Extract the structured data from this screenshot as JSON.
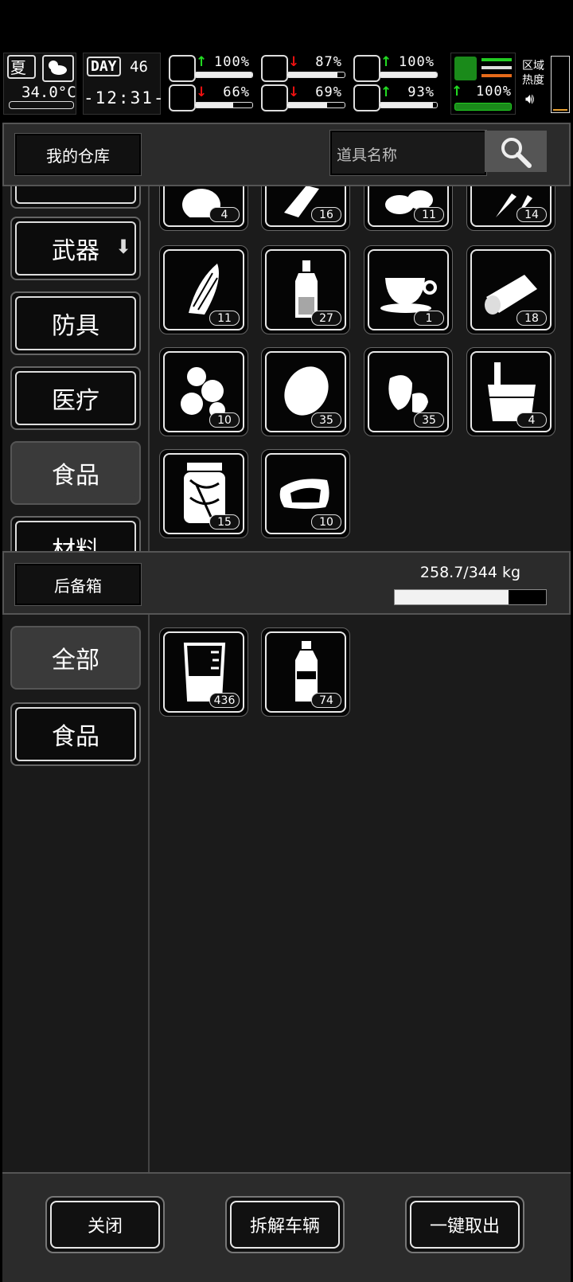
{
  "hud": {
    "season": "夏",
    "temperature": "34.0°C",
    "day_label": "DAY",
    "day_number": "46",
    "clock": "-12:31-",
    "stats": [
      {
        "name": "health",
        "trend": "up",
        "value": "100%",
        "level": 1.0
      },
      {
        "name": "stomach",
        "trend": "down",
        "value": "87%",
        "level": 0.87
      },
      {
        "name": "stamina",
        "trend": "up",
        "value": "100%",
        "level": 1.0
      },
      {
        "name": "mind",
        "trend": "down",
        "value": "66%",
        "level": 0.66
      },
      {
        "name": "water",
        "trend": "down",
        "value": "69%",
        "level": 0.69
      },
      {
        "name": "heart",
        "trend": "up",
        "value": "93%",
        "level": 0.93
      }
    ],
    "speed": {
      "trend": "up",
      "value": "100%"
    },
    "zone_heat_label": "区域\n热度",
    "zone_heat_line1": "区域",
    "zone_heat_line2": "热度"
  },
  "warehouse": {
    "title": "我的仓库",
    "search_placeholder": "道具名称",
    "categories": [
      "武器",
      "防具",
      "医疗",
      "食品",
      "材料"
    ],
    "selected_category": "食品",
    "items": [
      {
        "icon": "potato-icon",
        "count": "4"
      },
      {
        "icon": "bread-icon",
        "count": "16"
      },
      {
        "icon": "beans-icon",
        "count": "11"
      },
      {
        "icon": "carrot-icon",
        "count": "14"
      },
      {
        "icon": "corn-icon",
        "count": "11"
      },
      {
        "icon": "bottle-icon",
        "count": "27"
      },
      {
        "icon": "coffee-cup-icon",
        "count": "1"
      },
      {
        "icon": "canned-food-icon",
        "count": "18"
      },
      {
        "icon": "ginger-icon",
        "count": "10"
      },
      {
        "icon": "lemon-icon",
        "count": "35"
      },
      {
        "icon": "strawberry-icon",
        "count": "35"
      },
      {
        "icon": "bucket-icon",
        "count": "4"
      },
      {
        "icon": "pickle-jar-icon",
        "count": "15"
      },
      {
        "icon": "meat-icon",
        "count": "10"
      }
    ]
  },
  "trunk": {
    "title": "后备箱",
    "capacity_text": "258.7/344 kg",
    "capacity_fraction": 0.752,
    "categories": [
      "全部",
      "食品"
    ],
    "selected_category": "全部",
    "items": [
      {
        "icon": "beaker-icon",
        "count": "436"
      },
      {
        "icon": "water-bottle-icon",
        "count": "74"
      }
    ]
  },
  "buttons": {
    "close": "关闭",
    "dismantle": "拆解车辆",
    "take_all": "一键取出"
  }
}
